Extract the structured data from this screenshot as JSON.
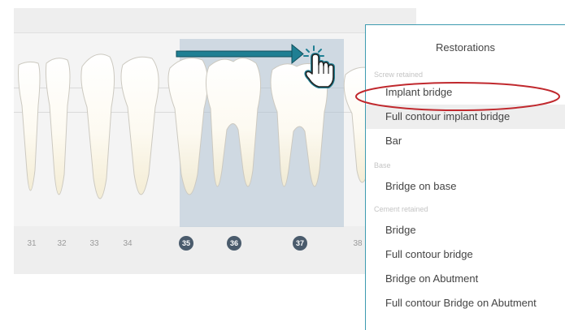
{
  "tooth_chart": {
    "numbers": [
      {
        "label": "31",
        "selected": false
      },
      {
        "label": "32",
        "selected": false
      },
      {
        "label": "33",
        "selected": false
      },
      {
        "label": "34",
        "selected": false
      },
      {
        "label": "35",
        "selected": true
      },
      {
        "label": "36",
        "selected": true
      },
      {
        "label": "37",
        "selected": true
      },
      {
        "label": "38",
        "selected": false
      }
    ]
  },
  "restorations_menu": {
    "title": "Restorations",
    "groups": [
      {
        "heading": "Screw retained",
        "items": [
          {
            "label": "Implant bridge",
            "circled": true
          },
          {
            "label": "Full contour implant bridge",
            "hovered": true
          },
          {
            "label": "Bar"
          }
        ]
      },
      {
        "heading": "Base",
        "items": [
          {
            "label": "Bridge on base"
          }
        ]
      },
      {
        "heading": "Cement retained",
        "items": [
          {
            "label": "Bridge"
          },
          {
            "label": "Full contour bridge"
          },
          {
            "label": "Bridge on Abutment"
          },
          {
            "label": "Full contour Bridge on Abutment"
          }
        ]
      }
    ]
  },
  "colors": {
    "selection": "#b0c2d4",
    "accent_teal": "#1f7f93",
    "highlight_oval": "#c0282d"
  }
}
